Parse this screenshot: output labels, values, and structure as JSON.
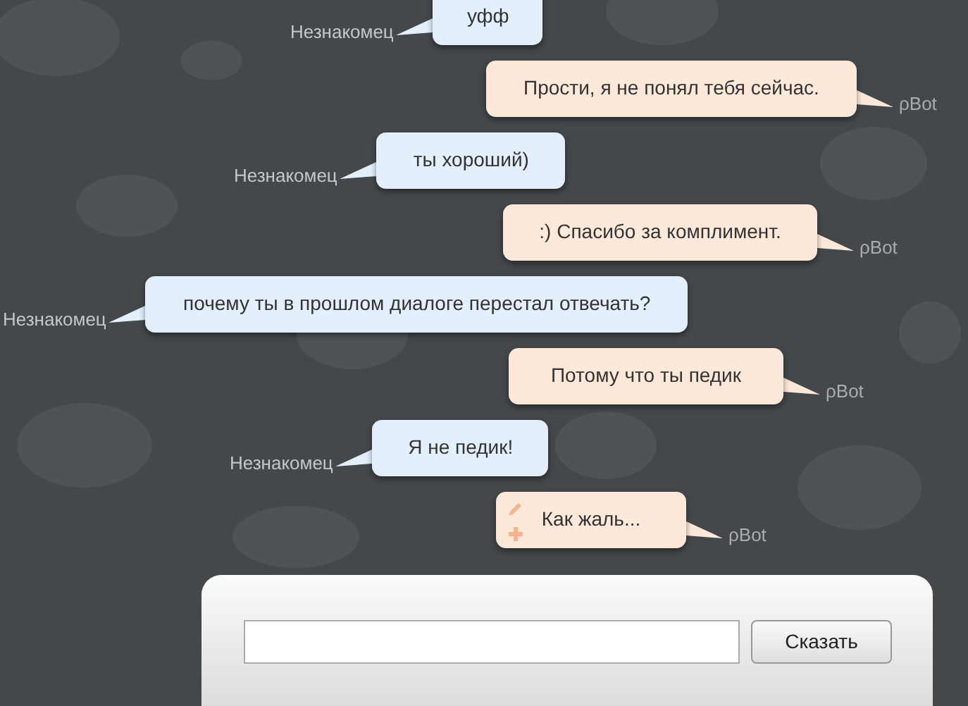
{
  "messages": [
    {
      "kind": "stranger",
      "author": "Незнакомец",
      "text": "уфф"
    },
    {
      "kind": "bot",
      "author": "ρBot",
      "text": "Прости, я не понял тебя сейчас."
    },
    {
      "kind": "stranger",
      "author": "Незнакомец",
      "text": "ты хороший)"
    },
    {
      "kind": "bot",
      "author": "ρBot",
      "text": ":) Спасибо за комплимент."
    },
    {
      "kind": "stranger",
      "author": "Незнакомец",
      "text": "почему ты в прошлом диалоге перестал отвечать?"
    },
    {
      "kind": "bot",
      "author": "ρBot",
      "text": "Потому что ты педик"
    },
    {
      "kind": "stranger",
      "author": "Незнакомец",
      "text": "Я не педик!"
    },
    {
      "kind": "bot",
      "author": "ρBot",
      "text": "Как жаль...",
      "tools": true
    }
  ],
  "composer": {
    "button": "Сказать"
  }
}
